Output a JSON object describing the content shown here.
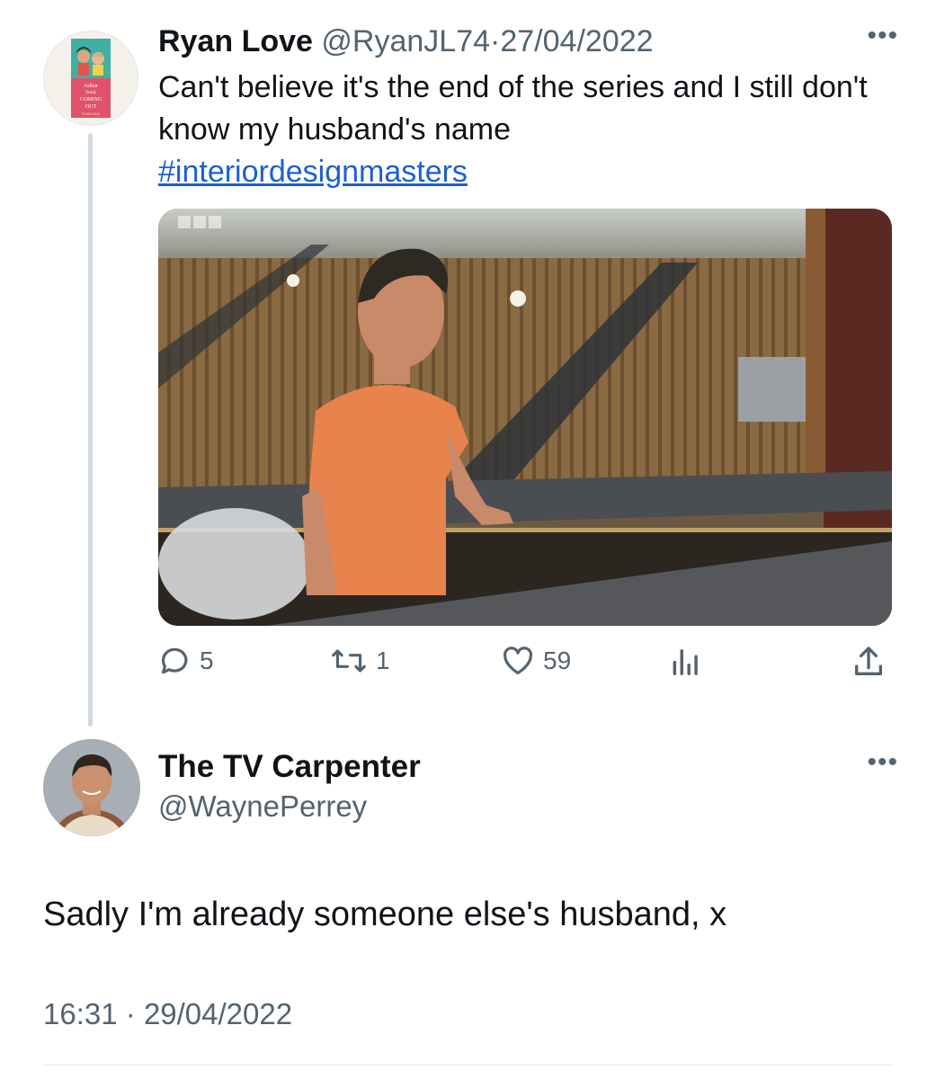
{
  "parent_tweet": {
    "author_name": "Ryan Love",
    "handle": "@RyanJL74",
    "separator": "·",
    "date": "27/04/2022",
    "more_label": "•••",
    "text": "Can't believe it's the end of the series and I still don't know my husband's name",
    "hashtag": "#interiordesignmasters",
    "avatar_book": {
      "title_line1": "Arthur",
      "title_and": "and",
      "title_line2": "Teddy",
      "title_are": "are",
      "title_line3": "COMING",
      "title_line4": "OUT",
      "author": "RYAN LOVE"
    },
    "media": {
      "broadcaster_logo": "BBC",
      "description_icon": "photo"
    },
    "actions": {
      "replies": {
        "icon": "reply-icon",
        "count": "5"
      },
      "retweets": {
        "icon": "retweet-icon",
        "count": "1"
      },
      "likes": {
        "icon": "heart-icon",
        "count": "59"
      },
      "views": {
        "icon": "analytics-icon"
      },
      "share": {
        "icon": "share-icon"
      }
    }
  },
  "reply_tweet": {
    "author_name": "The TV Carpenter",
    "handle": "@WaynePerrey",
    "more_label": "•••",
    "text": "Sadly I'm already someone else's husband, x",
    "time": "16:31",
    "separator": "·",
    "date": "29/04/2022"
  },
  "colors": {
    "text_primary": "#0f1419",
    "text_secondary": "#536471",
    "link": "#1d5fd4",
    "thread_line": "#cfd9de"
  }
}
